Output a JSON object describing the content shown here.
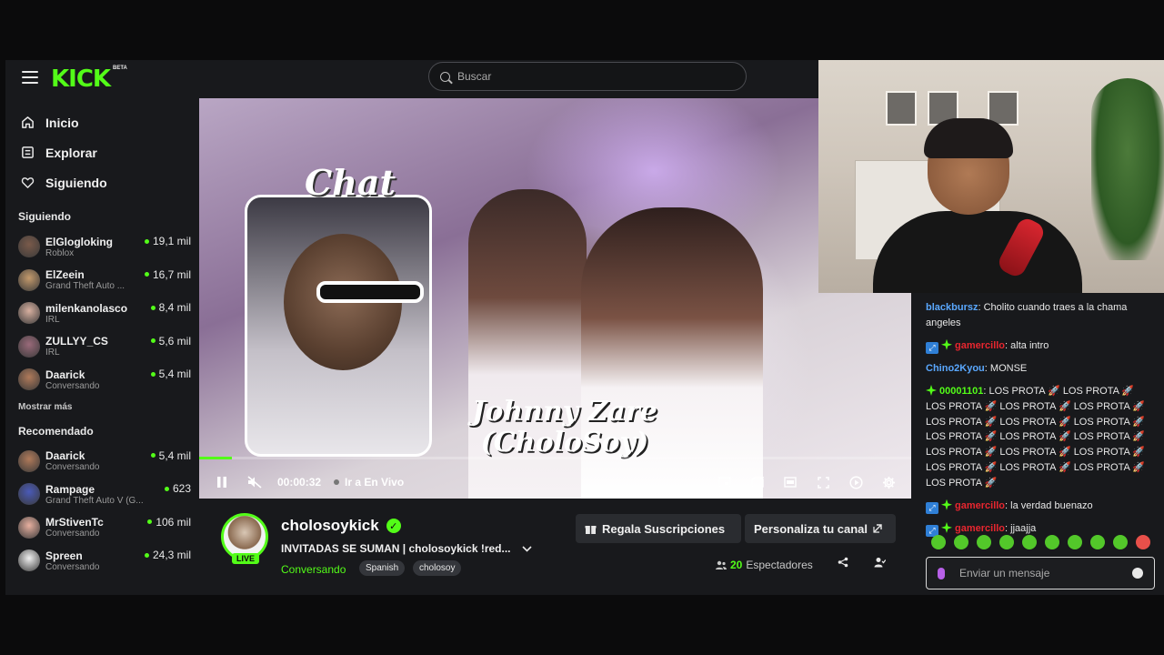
{
  "topbar": {
    "logo": "KICK",
    "logo_badge": "BETA",
    "search_placeholder": "Buscar"
  },
  "nav": [
    {
      "label": "Inicio",
      "icon": "home-icon"
    },
    {
      "label": "Explorar",
      "icon": "explore-icon"
    },
    {
      "label": "Siguiendo",
      "icon": "heart-icon"
    }
  ],
  "following": {
    "title": "Siguiendo",
    "items": [
      {
        "name": "ElGlogloking",
        "category": "Roblox",
        "viewers": "19,1 mil",
        "color": "#7a5a4a"
      },
      {
        "name": "ElZeein",
        "category": "Grand Theft Auto ...",
        "viewers": "16,7 mil",
        "color": "#c49a6c"
      },
      {
        "name": "milenkanolasco",
        "category": "IRL",
        "viewers": "8,4 mil",
        "color": "#d8b0a0"
      },
      {
        "name": "ZULLYY_CS",
        "category": "IRL",
        "viewers": "5,6 mil",
        "color": "#9a6a7a"
      },
      {
        "name": "Daarick",
        "category": "Conversando",
        "viewers": "5,4 mil",
        "color": "#b07a5a"
      }
    ],
    "show_more": "Mostrar más"
  },
  "recommended": {
    "title": "Recomendado",
    "items": [
      {
        "name": "Daarick",
        "category": "Conversando",
        "viewers": "5,4 mil",
        "color": "#b07a5a"
      },
      {
        "name": "Rampage",
        "category": "Grand Theft Auto V (G...",
        "viewers": "623",
        "color": "#4a5ab8"
      },
      {
        "name": "MrStivenTc",
        "category": "Conversando",
        "viewers": "106 mil",
        "color": "#e8b0a0"
      },
      {
        "name": "Spreen",
        "category": "Conversando",
        "viewers": "24,3 mil",
        "color": "#f0f0f0"
      }
    ]
  },
  "video": {
    "overlay_chat": "Chat",
    "overlay_name_1": "Johnny Zare",
    "overlay_name_2": "(CholoSoy)",
    "progress": 0.046,
    "time": "00:00:32",
    "go_live": "Ir a En Vivo"
  },
  "stream": {
    "channel": "cholosoykick",
    "live_badge": "LIVE",
    "title": "INVITADAS SE SUMAN | cholosoykick !red...",
    "category": "Conversando",
    "tags": [
      "Spanish",
      "cholosoy"
    ],
    "gift_button": "Regala Suscripciones",
    "customize_button": "Personaliza tu canal",
    "viewer_count": "20",
    "viewer_label": "Espectadores"
  },
  "chat": {
    "messages": [
      {
        "user": "blackbursz",
        "color": "#5aa8ff",
        "badges": [],
        "text": "Cholito cuando traes a la chama angeles"
      },
      {
        "user": "gamercillo",
        "color": "#e8262f",
        "badges": [
          "blue",
          "green"
        ],
        "text": "alta intro"
      },
      {
        "user": "Chino2Kyou",
        "color": "#5aa8ff",
        "badges": [],
        "text": "MONSE"
      },
      {
        "user": "00001101",
        "color": "#53fc18",
        "badges": [
          "green"
        ],
        "text": "LOS PROTA 🚀 LOS PROTA 🚀 LOS PROTA 🚀 LOS PROTA 🚀 LOS PROTA 🚀 LOS PROTA 🚀 LOS PROTA 🚀 LOS PROTA 🚀 LOS PROTA 🚀 LOS PROTA 🚀 LOS PROTA 🚀 LOS PROTA 🚀 LOS PROTA 🚀 LOS PROTA 🚀 LOS PROTA 🚀 LOS PROTA 🚀 LOS PROTA 🚀 LOS PROTA 🚀"
      },
      {
        "user": "gamercillo",
        "color": "#e8262f",
        "badges": [
          "blue",
          "green"
        ],
        "text": "la verdad buenazo"
      },
      {
        "user": "gamercillo",
        "color": "#e8262f",
        "badges": [
          "blue",
          "green"
        ],
        "text": "jjaajja"
      }
    ],
    "input_placeholder": "Enviar un mensaje"
  }
}
